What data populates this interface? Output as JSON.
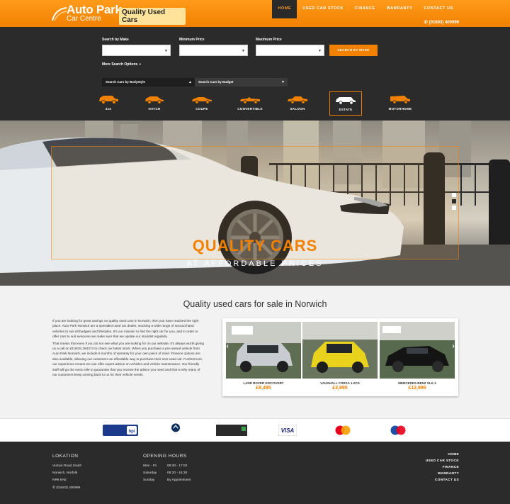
{
  "header": {
    "logo_main": "Auto Park",
    "logo_sub": "Car Centre",
    "logo_tag": "Quality Used Cars",
    "nav": [
      "HOME",
      "USED CAR STOCK",
      "FINANCE",
      "WARRANTY",
      "CONTACT US"
    ],
    "phone": "(01603) 400999",
    "colors": {
      "accent": "#f28100",
      "dark": "#2b2b2b"
    }
  },
  "search": {
    "make_label": "Search by Make",
    "min_label": "Minimum Price",
    "max_label": "Maximum Price",
    "button": "SEARCH BY MAKE",
    "more_options": "More Search Options",
    "tab_bodystyle": "Search Cars by BodyStyle",
    "tab_budget": "Search Cars by Budget",
    "categories": [
      "4x4",
      "HATCH",
      "COUPE",
      "CONVERTIBLE",
      "SALOON",
      "ESTATE",
      "MOTORHOME"
    ],
    "selected_category": "ESTATE"
  },
  "hero": {
    "title": "QUALITY CARS",
    "subtitle": "AT AFFORDABLE PRICES"
  },
  "content": {
    "title": "Quality used cars for sale in Norwich",
    "paragraphs": [
      "If you are looking for great savings on quality used cars in Norwich, then you have reached the right place. Auto Park Norwich are a specialist used car dealer, stocking a wide range of second hand vehicles to suit all budgets and lifestyles. It's our mission to find the right car for you, and in order to offer cars to suit everyone we make sure that we update our stocklist regularly.",
      "That means that even if you do not see what you are looking for on our website, it's always worth giving us a call on (01603) 384374 to check our latest stock. When you purchase a pre-owned vehicle from Auto Park Norwich, we include 6 months of warranty for your own piece of mind. Finance options are also available, allowing our customers an affordable way to purchase their next used car. Furthermore, our experience means we can offer expert advice on vehicles and vehicle maintenance. Our friendly staff will go the extra mile to guarantee that you receive the advice you need and that is why many of our customers keep coming back to us for their vehicle needs."
    ],
    "cars": [
      {
        "name": "LAND ROVER DISCOVERY",
        "price": "£8,495"
      },
      {
        "name": "VAUXHALL CORSA 1.2CD",
        "price": "£3,995"
      },
      {
        "name": "MERCEDES-BENZ SLK-3",
        "price": "£12,995"
      }
    ]
  },
  "footer": {
    "lokation_title": "LOKATION",
    "address": [
      "Vulcan Road South",
      "Norwich, Norfolk",
      "NR6 6AE"
    ],
    "phone": "(01603) 400999",
    "hours_title": "OPENING HOURS",
    "hours": [
      {
        "day": "Mon - Fri",
        "time": "09:30 - 17:00"
      },
      {
        "day": "Saturday",
        "time": "09:30 - 16:30"
      },
      {
        "day": "Sunday",
        "time": "By Appointment"
      }
    ],
    "links": [
      "HOME",
      "USED CAR STOCK",
      "FINANCE",
      "WARRANTY",
      "CONTACT US"
    ]
  }
}
